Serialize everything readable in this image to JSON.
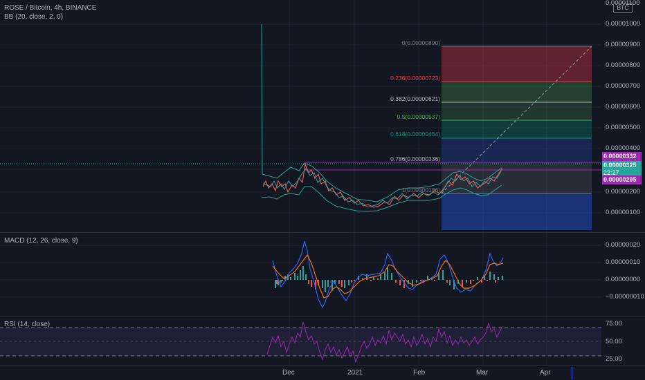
{
  "header": {
    "symbol_title": "ROSE / Bitcoin, 4h, BINANCE",
    "bb_indicator": "BB (20, close, 2, 0)",
    "currency_button": "BTC"
  },
  "price_axis": {
    "ticks": [
      "0.00001100",
      "0.00001000",
      "0.00000900",
      "0.00000800",
      "0.00000700",
      "0.00000600",
      "0.00000500",
      "0.00000400",
      "0.00000200",
      "0.00000100"
    ],
    "tags": {
      "high": "0.00000332",
      "last": "0.00000325",
      "countdown": "22:27",
      "low": "0.00000295"
    }
  },
  "fib_levels": [
    {
      "label": "0(0.00000890)",
      "color": "#787b86"
    },
    {
      "label": "0.236(0.00000723)",
      "color": "#f23645"
    },
    {
      "label": "0.382(0.00000621)",
      "color": "#b2b5be"
    },
    {
      "label": "0.5(0.00000537)",
      "color": "#4caf50"
    },
    {
      "label": "0.618(0.00000454)",
      "color": "#089981"
    },
    {
      "label": "0.786(0.00000336)",
      "color": "#b2b5be"
    },
    {
      "label": "1(0.00000186)",
      "color": "#787b86"
    }
  ],
  "macd": {
    "legend": "MACD (12, 26, close, 9)",
    "ticks": [
      "0.00000020",
      "0.00000010",
      "0.00000000",
      "−0.00000010"
    ]
  },
  "rsi": {
    "legend": "RSI (14, close)",
    "ticks": [
      "75.00",
      "50.00",
      "25.00"
    ]
  },
  "time_axis": {
    "labels": [
      "Dec",
      "2021",
      "Feb",
      "Mar",
      "Apr"
    ]
  },
  "colors": {
    "background": "#131722",
    "up": "#26a69a",
    "down": "#ef5350",
    "bb_band": "#26a69a",
    "macd_line": "#2962ff",
    "signal_line": "#ff6d00",
    "rsi_line": "#9c27b0",
    "accent_tag": "#9c27b0",
    "last_price_tag": "#26a69a"
  }
}
